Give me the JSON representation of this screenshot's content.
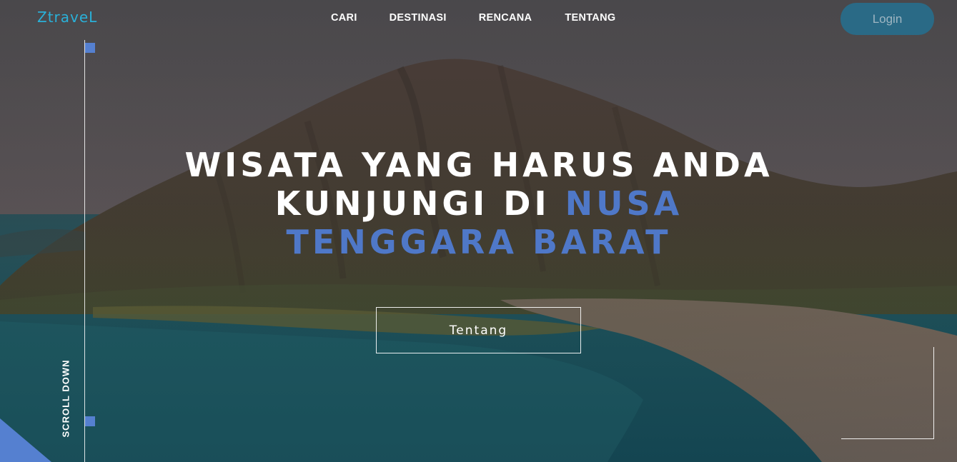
{
  "brand": {
    "logo_text": "ZtraveL"
  },
  "nav": {
    "items": [
      {
        "label": "CARI"
      },
      {
        "label": "DESTINASI"
      },
      {
        "label": "RENCANA"
      },
      {
        "label": "TENTANG"
      }
    ],
    "login_label": "Login"
  },
  "hero": {
    "title_line1": "WISATA YANG HARUS ANDA",
    "title_line2_white": "KUNJUNGI DI ",
    "title_line2_highlight": "NUSA",
    "title_line3_highlight": "TENGGARA BARAT",
    "button_label": "Tentang"
  },
  "rail": {
    "scroll_label": "SCROLL DOWN"
  },
  "colors": {
    "accent": "#4f78c8",
    "logo": "#2ab0d8",
    "login_bg": "#2a6a86"
  }
}
